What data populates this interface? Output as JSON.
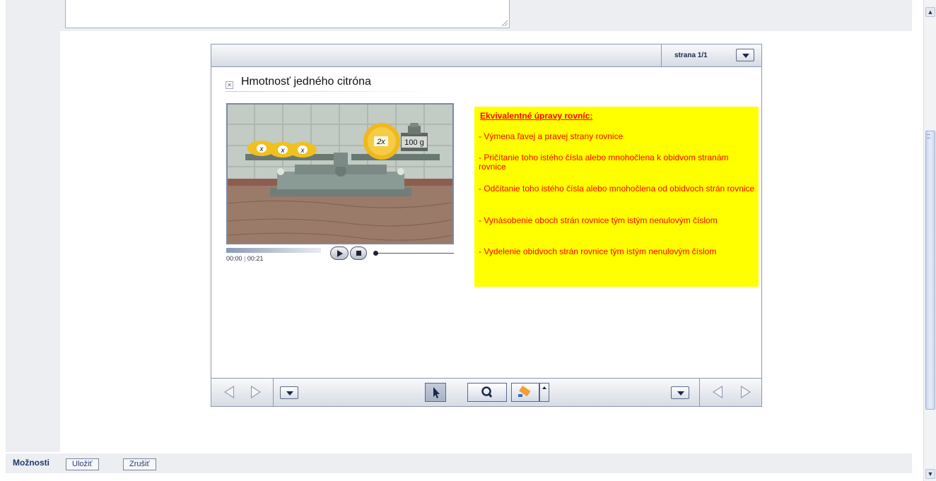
{
  "options": {
    "label": "Možnosti",
    "save_label": "Uložiť",
    "cancel_label": "Zrušiť"
  },
  "player": {
    "page_indicator": "strana  1/1",
    "slide_title": "Hmotnosť jedného citróna",
    "video": {
      "time_current": "00:00",
      "time_total": "00:21",
      "lemon_labels": [
        "x",
        "x",
        "x"
      ],
      "big_lemon_label": "2x",
      "weight_label": "100 g"
    },
    "note": {
      "title": "Ekvivalentné úpravy rovníc:",
      "items": [
        "-  Výmena ľavej a pravej strany rovnice",
        "- Pričítanie toho istého čísla alebo mnohočlena k obidvom stranám rovnice",
        "- Odčítanie toho istého čísla alebo mnohočlena od obidvoch strán rovnice",
        "- Vynásobenie oboch strán rovnice tým istým nenulovým číslom",
        "- Vydelenie obidvoch strán rovnice tým istým nenulovým číslom"
      ]
    }
  },
  "colors": {
    "note_bg": "#ffff00",
    "note_text": "#ff0000",
    "frame_border": "#8b98b0"
  }
}
